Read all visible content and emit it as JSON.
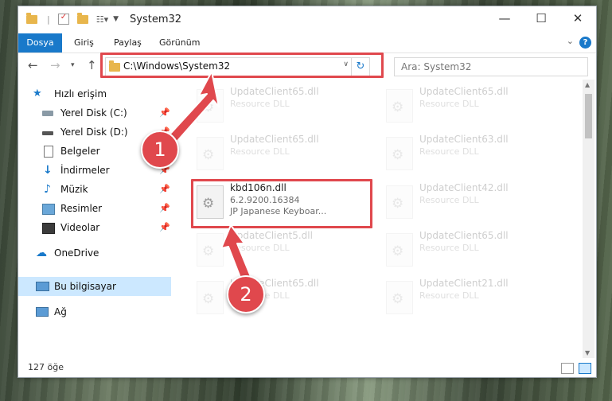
{
  "window": {
    "title": "System32"
  },
  "ribbon": {
    "tabs": [
      "Dosya",
      "Giriş",
      "Paylaş",
      "Görünüm"
    ],
    "help": "?"
  },
  "address": {
    "path": "C:\\Windows\\System32"
  },
  "search": {
    "placeholder": "Ara: System32"
  },
  "navpane": {
    "items": [
      {
        "label": "Hızlı erişim"
      },
      {
        "label": "Yerel Disk (C:)"
      },
      {
        "label": "Yerel Disk (D:)"
      },
      {
        "label": "Belgeler"
      },
      {
        "label": "İndirmeler"
      },
      {
        "label": "Müzik"
      },
      {
        "label": "Resimler"
      },
      {
        "label": "Videolar"
      },
      {
        "label": "OneDrive"
      },
      {
        "label": "Bu bilgisayar"
      },
      {
        "label": "Ağ"
      }
    ]
  },
  "files": {
    "highlight": {
      "name": "kbd106n.dll",
      "version": "6.2.9200.16384",
      "description": "JP Japanese Keyboar..."
    },
    "faded": [
      {
        "name": "UpdateClient65.dll",
        "type": "Resource DLL"
      },
      {
        "name": "UpdateClient65.dll",
        "type": "Resource DLL"
      },
      {
        "name": "UpdateClient65.dll",
        "type": "Resource DLL"
      },
      {
        "name": "UpdateClient63.dll",
        "type": "Resource DLL"
      },
      {
        "name": "UpdateClient42.dll",
        "type": "Resource DLL"
      },
      {
        "name": "UpdateClient5.dll",
        "type": "Resource DLL"
      },
      {
        "name": "UpdateClient65.dll",
        "type": "Resource DLL"
      },
      {
        "name": "UpdateClient65.dll",
        "type": "Resource DLL"
      },
      {
        "name": "UpdateClient21.dll",
        "type": "Resource DLL"
      }
    ]
  },
  "status": {
    "count": "127 öğe"
  },
  "callouts": {
    "one": "1",
    "two": "2"
  },
  "colors": {
    "accent": "#1979ca",
    "highlight": "#e0484d",
    "selected": "#cce8ff"
  }
}
